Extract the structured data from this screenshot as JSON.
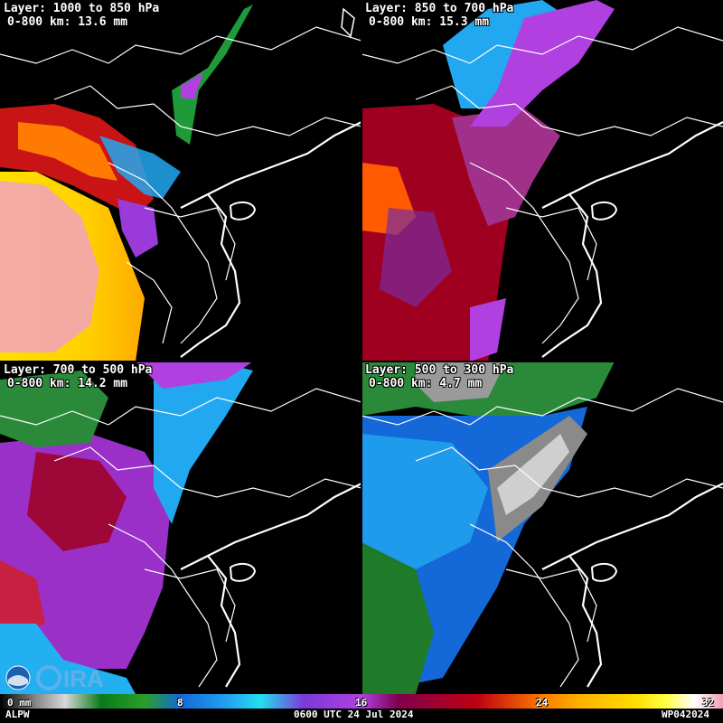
{
  "panels": [
    {
      "layer": "Layer: 1000 to 850 hPa",
      "total": "0-800 km: 13.6 mm"
    },
    {
      "layer": "Layer: 850 to 700 hPa",
      "total": "0-800 km: 15.3 mm"
    },
    {
      "layer": "Layer: 700 to 500 hPa",
      "total": "0-800 km: 14.2 mm"
    },
    {
      "layer": "Layer: 500 to 300 hPa",
      "total": "0-800 km: 4.7 mm"
    }
  ],
  "colorbar": {
    "ticks": [
      "0 mm",
      "8",
      "16",
      "24",
      "32"
    ]
  },
  "footer": {
    "product": "ALPW",
    "time": "0600 UTC 24 Jul 2024",
    "id": "WP042024"
  },
  "logo": {
    "text": "CIRA"
  }
}
